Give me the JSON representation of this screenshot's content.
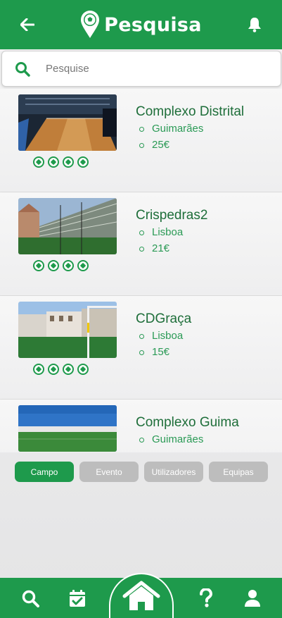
{
  "header": {
    "title": "Pesquisa",
    "back_icon": "arrow-left-icon",
    "logo_icon": "soccer-ball-pin-icon",
    "notification_icon": "bell-icon"
  },
  "search": {
    "placeholder": "Pesquise",
    "value": "",
    "icon": "search-icon"
  },
  "results": [
    {
      "name": "Complexo Distrital",
      "location": "Guimarães",
      "price": "25€",
      "rating": 4,
      "photo": "indoor-futsal-court"
    },
    {
      "name": "Crispedras2",
      "location": "Lisboa",
      "price": "21€",
      "rating": 4,
      "photo": "outdoor-field-with-stands"
    },
    {
      "name": "CDGraça",
      "location": "Lisboa",
      "price": "15€",
      "rating": 4,
      "photo": "urban-field-with-goal"
    },
    {
      "name": "Complexo Guima",
      "location": "Guimarães",
      "price": "",
      "rating": 0,
      "photo": "open-field-blue-sky"
    }
  ],
  "tabs": [
    {
      "label": "Campo",
      "active": true
    },
    {
      "label": "Evento",
      "active": false
    },
    {
      "label": "Utilizadores",
      "active": false
    },
    {
      "label": "Equipas",
      "active": false
    }
  ],
  "bottom_nav": {
    "items": [
      "search-icon",
      "calendar-check-icon",
      "home-icon",
      "help-icon",
      "user-icon"
    ]
  },
  "colors": {
    "brand_green": "#1e9a4c",
    "text_green": "#2a9a55",
    "tab_inactive": "#bdbdbd"
  }
}
